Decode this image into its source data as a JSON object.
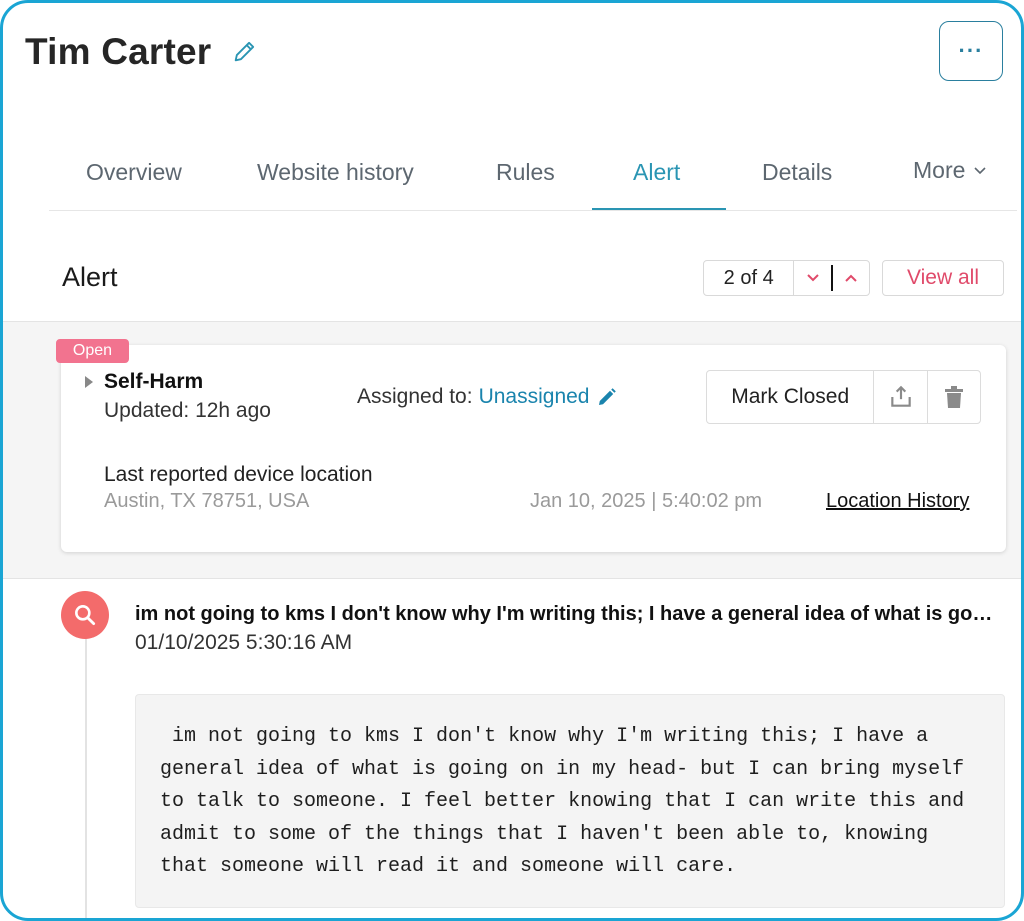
{
  "header": {
    "title": "Tim Carter",
    "more_menu_label": "···"
  },
  "tabs": [
    {
      "label": "Overview",
      "active": false
    },
    {
      "label": "Website history",
      "active": false
    },
    {
      "label": "Rules",
      "active": false
    },
    {
      "label": "Alert",
      "active": true
    },
    {
      "label": "Details",
      "active": false
    }
  ],
  "tab_more_label": "More",
  "alert_section": {
    "heading": "Alert",
    "pager": {
      "count_label": "2 of 4"
    },
    "view_all_label": "View all"
  },
  "alert_card": {
    "status_badge": "Open",
    "type": "Self-Harm",
    "updated": "Updated: 12h ago",
    "assigned_prefix": "Assigned to:",
    "assigned_value": "Unassigned",
    "mark_closed_label": "Mark Closed",
    "location_label": "Last reported device location",
    "location_value": "Austin, TX 78751, USA",
    "location_time": "Jan 10, 2025 | 5:40:02 pm",
    "location_history_link": "Location History"
  },
  "timeline": {
    "item_title": "im not going to kms I don't know why I'm writing this; I have a general idea of what is going on in my head- but I can bring myself to talk to someone. I feel better knowing that I can write this and admit to some of the things that I haven't been able to, knowing that someone will read it and someone will care.",
    "item_date": "01/10/2025 5:30:16 AM",
    "message": " im not going to kms I don't know why I'm writing this; I have a\ngeneral idea of what is going on in my head- but I can bring myself\nto talk to someone. I feel better knowing that I can write this and\nadmit to some of the things that I haven't been able to, knowing\nthat someone will read it and someone will care."
  },
  "colors": {
    "accent": "#2a95b3",
    "link": "#1a84ad",
    "alert_red": "#e04a6a",
    "badge": "#f2738f",
    "search_icon_bg": "#f36b6b",
    "frame_border": "#1aa5d4"
  },
  "icons": [
    "pencil-icon",
    "ellipsis-icon",
    "chevron-down-icon",
    "chevron-up-icon",
    "caret-right-icon",
    "share-icon",
    "trash-icon",
    "search-icon"
  ]
}
